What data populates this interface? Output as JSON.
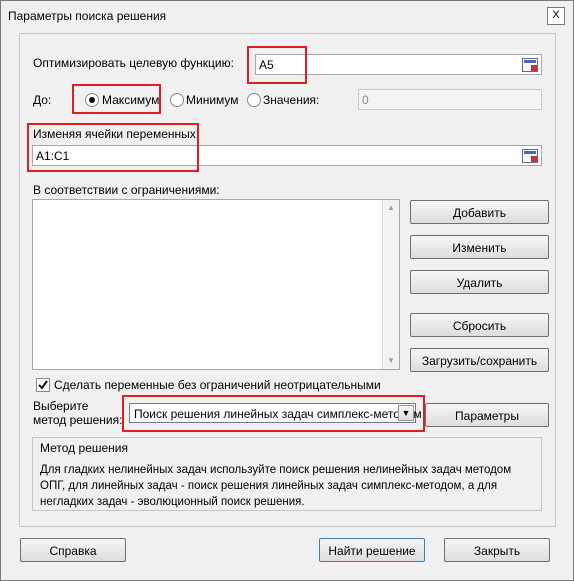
{
  "window": {
    "title": "Параметры поиска решения",
    "close_label": "X"
  },
  "objective": {
    "label": "Оптимизировать целевую функцию:",
    "value": "A5"
  },
  "to": {
    "label": "До:",
    "options": [
      {
        "label": "Максимум",
        "selected": true
      },
      {
        "label": "Минимум",
        "selected": false
      },
      {
        "label": "Значения:",
        "selected": false
      }
    ],
    "value_field": "0"
  },
  "variables": {
    "label": "Изменяя ячейки переменных:",
    "value": "A1:C1"
  },
  "constraints": {
    "label": "В соответствии с ограничениями:",
    "items": []
  },
  "buttons": {
    "add": "Добавить",
    "change": "Изменить",
    "delete": "Удалить",
    "reset": "Сбросить",
    "load_save": "Загрузить/сохранить",
    "options": "Параметры"
  },
  "nonneg": {
    "label": "Сделать переменные без ограничений неотрицательными",
    "checked": true
  },
  "method": {
    "label_line1": "Выберите",
    "label_line2": "метод решения:",
    "selected": "Поиск решения линейных задач симплекс-методом"
  },
  "method_description": {
    "title": "Метод решения",
    "text": "Для гладких нелинейных задач используйте поиск решения нелинейных задач методом ОПГ, для линейных задач - поиск решения линейных задач симплекс-методом, а для негладких задач - эволюционный поиск решения."
  },
  "footer": {
    "help": "Справка",
    "solve": "Найти решение",
    "close": "Закрыть"
  },
  "colors": {
    "highlight": "#e01e24",
    "background": "#f0f0f0"
  }
}
